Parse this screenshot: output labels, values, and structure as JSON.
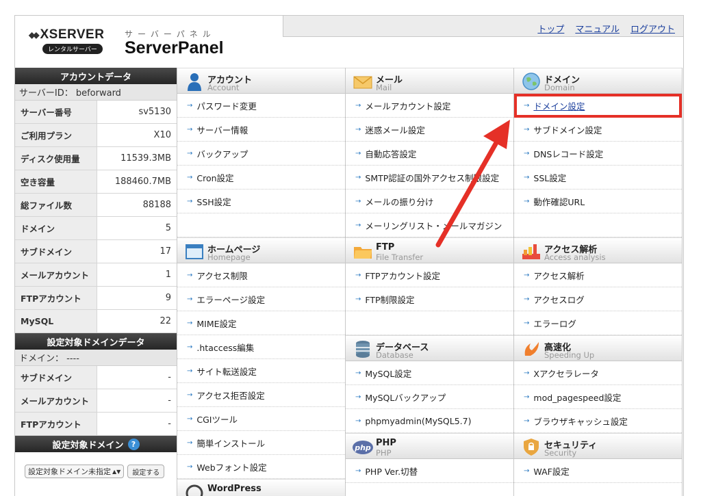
{
  "header": {
    "brand": "XSERVER",
    "brand_badge": "レンタルサーバー",
    "panel_kana": "サーバーパネル",
    "panel_name": "ServerPanel",
    "links": [
      "トップ",
      "マニュアル",
      "ログアウト"
    ]
  },
  "sidebar": {
    "account_title": "アカウントデータ",
    "server_id": "サーバーID： beforward",
    "account_rows": [
      {
        "k": "サーバー番号",
        "v": "sv5130"
      },
      {
        "k": "ご利用プラン",
        "v": "X10"
      },
      {
        "k": "ディスク使用量",
        "v": "11539.3MB"
      },
      {
        "k": "空き容量",
        "v": "188460.7MB"
      },
      {
        "k": "総ファイル数",
        "v": "88188"
      },
      {
        "k": "ドメイン",
        "v": "5"
      },
      {
        "k": "サブドメイン",
        "v": "17"
      },
      {
        "k": "メールアカウント",
        "v": "1"
      },
      {
        "k": "FTPアカウント",
        "v": "9"
      },
      {
        "k": "MySQL",
        "v": "22"
      }
    ],
    "domain_title": "設定対象ドメインデータ",
    "domain_label": "ドメイン： ----",
    "domain_rows": [
      {
        "k": "サブドメイン",
        "v": "-"
      },
      {
        "k": "メールアカウント",
        "v": "-"
      },
      {
        "k": "FTPアカウント",
        "v": "-"
      }
    ],
    "target_title": "設定対象ドメイン",
    "target_select": "設定対象ドメイン未指定",
    "target_button": "設定する"
  },
  "columns": [
    {
      "sections": [
        {
          "jp": "アカウント",
          "en": "Account",
          "icon": "person-icon",
          "items": [
            "パスワード変更",
            "サーバー情報",
            "バックアップ",
            "Cron設定",
            "SSH設定"
          ],
          "empty": 1
        },
        {
          "jp": "ホームページ",
          "en": "Homepage",
          "icon": "window-icon",
          "items": [
            "アクセス制限",
            "エラーページ設定",
            "MIME設定",
            ".htaccess編集",
            "サイト転送設定",
            "アクセス拒否設定",
            "CGIツール",
            "簡単インストール",
            "Webフォント設定"
          ],
          "empty": 0
        },
        {
          "jp": "WordPress",
          "en": "",
          "icon": "wordpress-icon",
          "items": [],
          "empty": 0
        }
      ]
    },
    {
      "sections": [
        {
          "jp": "メール",
          "en": "Mail",
          "icon": "envelope-icon",
          "items": [
            "メールアカウント設定",
            "迷惑メール設定",
            "自動応答設定",
            "SMTP認証の国外アクセス制限設定",
            "メールの振り分け",
            "メーリングリスト・メールマガジン"
          ],
          "empty": 0
        },
        {
          "jp": "FTP",
          "en": "File Transfer",
          "icon": "folder-icon",
          "items": [
            "FTPアカウント設定",
            "FTP制限設定"
          ],
          "empty": 1
        },
        {
          "jp": "データベース",
          "en": "Database",
          "icon": "database-icon",
          "items": [
            "MySQL設定",
            "MySQLバックアップ",
            "phpmyadmin(MySQL5.7)"
          ],
          "empty": 0
        },
        {
          "jp": "PHP",
          "en": "PHP",
          "icon": "php-icon",
          "items": [
            "PHP Ver.切替"
          ],
          "empty": 0
        }
      ]
    },
    {
      "sections": [
        {
          "jp": "ドメイン",
          "en": "Domain",
          "icon": "globe-icon",
          "items": [
            "ドメイン設定",
            "サブドメイン設定",
            "DNSレコード設定",
            "SSL設定",
            "動作確認URL"
          ],
          "empty": 1
        },
        {
          "jp": "アクセス解析",
          "en": "Access analysis",
          "icon": "chart-icon",
          "items": [
            "アクセス解析",
            "アクセスログ",
            "エラーログ"
          ],
          "empty": 0
        },
        {
          "jp": "高速化",
          "en": "Speeding Up",
          "icon": "rocket-icon",
          "items": [
            "Xアクセラレータ",
            "mod_pagespeed設定",
            "ブラウザキャッシュ設定"
          ],
          "empty": 0
        },
        {
          "jp": "セキュリティ",
          "en": "Security",
          "icon": "shield-icon",
          "items": [
            "WAF設定"
          ],
          "empty": 0
        }
      ]
    }
  ],
  "highlight": "ドメイン設定",
  "colors": {
    "highlight": "#e53027",
    "link": "#1a3e9c",
    "arrow_bullet": "#2a78c0"
  }
}
